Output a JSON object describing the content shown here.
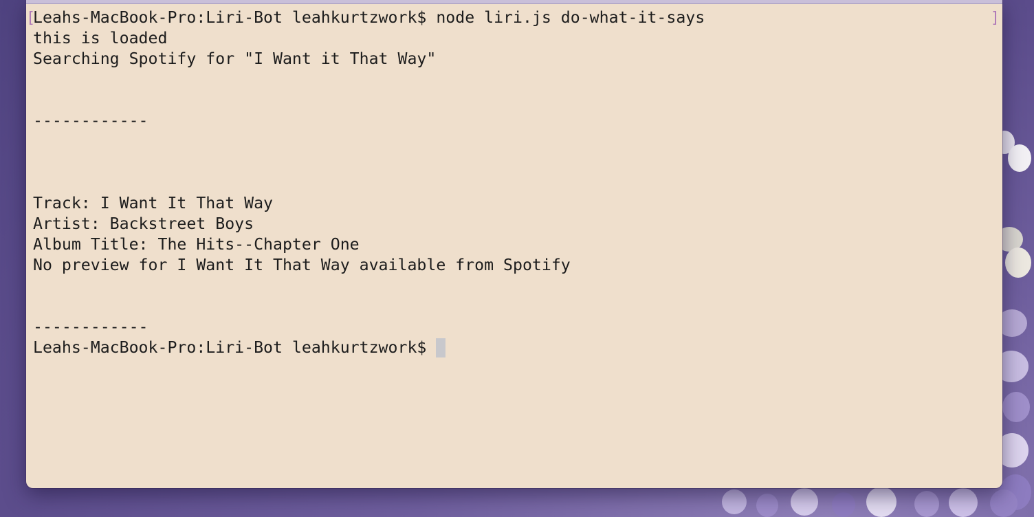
{
  "terminal": {
    "lines": [
      "Leahs-MacBook-Pro:Liri-Bot leahkurtzwork$ node liri.js do-what-it-says",
      "this is loaded",
      "Searching Spotify for \"I Want it That Way\"",
      "",
      "",
      "------------",
      "",
      "",
      "",
      "Track: I Want It That Way",
      "Artist: Backstreet Boys",
      "Album Title: The Hits--Chapter One",
      "No preview for I Want It That Way available from Spotify",
      "",
      "",
      "------------"
    ],
    "prompt": "Leahs-MacBook-Pro:Liri-Bot leahkurtzwork$ ",
    "mark_left": "[",
    "mark_right": "]"
  },
  "colors": {
    "terminal_background": "#efdfcc",
    "text": "#1c1c1c",
    "cursor": "#c8c8cc",
    "mark": "#b07ab8",
    "desktop": "#6f5f9e"
  }
}
